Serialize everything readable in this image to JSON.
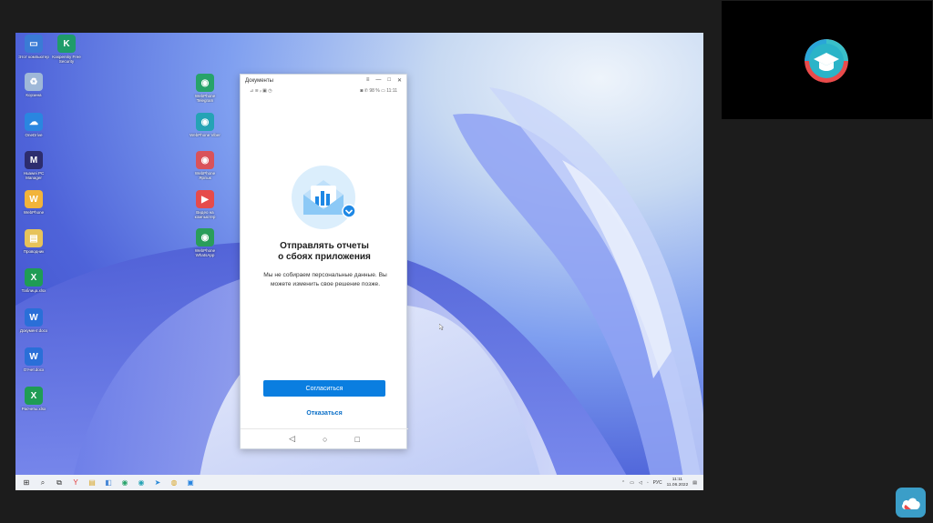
{
  "desktop": {
    "icons": [
      {
        "label": "Этот компьютер",
        "color": "#3a7bd5",
        "glyph": "▭"
      },
      {
        "label": "Kaspersky Free Security",
        "color": "#1f9c6a",
        "glyph": "K"
      },
      {
        "label": "Корзина",
        "color": "#9fb8d8",
        "glyph": "♻"
      },
      {
        "label": "OneDrive",
        "color": "#2a86e0",
        "glyph": "☁"
      },
      {
        "label": "Huawei PC Manager",
        "color": "#2d2d6e",
        "glyph": "M"
      },
      {
        "label": "WebPhone",
        "color": "#f2b43a",
        "glyph": "W"
      },
      {
        "label": "Проводник",
        "color": "#e7c35a",
        "glyph": "▤"
      },
      {
        "label": "Таблица.xlsx",
        "color": "#1f9c55",
        "glyph": "X"
      },
      {
        "label": "Документ.docx",
        "color": "#2a6fd8",
        "glyph": "W"
      },
      {
        "label": "Отчет.docx",
        "color": "#2a6fd8",
        "glyph": "W"
      },
      {
        "label": "Расчеты.xlsx",
        "color": "#1f9c55",
        "glyph": "X"
      },
      {
        "label": "WebPhone Telegram",
        "color": "#27a36a",
        "glyph": "◉"
      },
      {
        "label": "WebPhone Viber",
        "color": "#25a3b5",
        "glyph": "◉"
      },
      {
        "label": "WebPhone Ярлык",
        "color": "#d9535a",
        "glyph": "◉"
      },
      {
        "label": "Видео на компьютер",
        "color": "#e64b4b",
        "glyph": "▶"
      },
      {
        "label": "WebPhone WhatsApp",
        "color": "#2a9d5a",
        "glyph": "◉"
      }
    ]
  },
  "phone_window": {
    "title": "Документы",
    "status_left": "⊿ ≋ ᵢₗ ▣ ◷",
    "status_right": "◙ ✆ 98 % ▭ 11:11",
    "heading_line1": "Отправлять отчеты",
    "heading_line2": "о сбоях приложения",
    "description": "Мы не собираем персональные данные. Вы можете изменить свое решение позже.",
    "agree_label": "Согласиться",
    "refuse_label": "Отказаться",
    "nav_back": "◁",
    "nav_home": "○",
    "nav_recent": "□",
    "window_controls": [
      "≡",
      "—",
      "□",
      "✕"
    ]
  },
  "taskbar": {
    "items": [
      {
        "icon": "windows-start-icon",
        "glyph": "⊞",
        "color": "#333"
      },
      {
        "icon": "search-icon",
        "glyph": "⌕",
        "color": "#333"
      },
      {
        "icon": "task-view-icon",
        "glyph": "⧉",
        "color": "#333"
      },
      {
        "icon": "yandex-icon",
        "glyph": "Y",
        "color": "#e23b3b"
      },
      {
        "icon": "explorer-icon",
        "glyph": "▤",
        "color": "#d9a72a"
      },
      {
        "icon": "app-icon",
        "glyph": "◧",
        "color": "#4b8ad8"
      },
      {
        "icon": "webphone-icon",
        "glyph": "◉",
        "color": "#27a36a"
      },
      {
        "icon": "webphone-icon-2",
        "glyph": "◉",
        "color": "#25a3b5"
      },
      {
        "icon": "telegram-icon",
        "glyph": "➤",
        "color": "#2a8ad8"
      },
      {
        "icon": "chrome-icon",
        "glyph": "◍",
        "color": "#d9a72a"
      },
      {
        "icon": "phone-app-icon",
        "glyph": "▣",
        "color": "#2a86e0"
      }
    ],
    "tray": {
      "language": "РУС",
      "time": "11:11",
      "date": "11.06.2022"
    }
  },
  "colors": {
    "accent": "#0a7ee0",
    "link": "#0a6fc8"
  }
}
